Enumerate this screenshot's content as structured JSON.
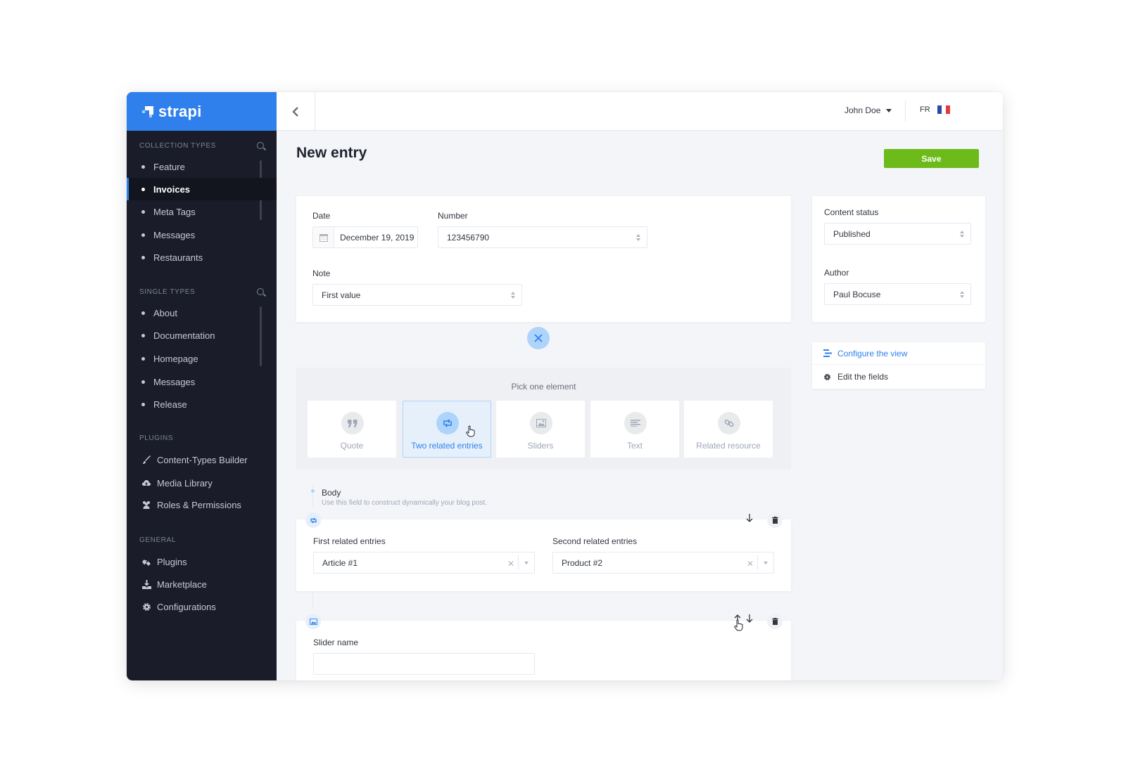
{
  "brand": {
    "name": "strapi"
  },
  "sidebar": {
    "collection_types": {
      "title": "Collection Types",
      "items": [
        {
          "label": "Feature"
        },
        {
          "label": "Invoices"
        },
        {
          "label": "Meta Tags"
        },
        {
          "label": "Messages"
        },
        {
          "label": "Restaurants"
        }
      ]
    },
    "single_types": {
      "title": "Single Types",
      "items": [
        {
          "label": "About"
        },
        {
          "label": "Documentation"
        },
        {
          "label": "Homepage"
        },
        {
          "label": "Messages"
        },
        {
          "label": "Release"
        }
      ]
    },
    "plugins": {
      "title": "Plugins",
      "items": [
        {
          "label": "Content-Types Builder",
          "icon": "brush-icon"
        },
        {
          "label": "Media Library",
          "icon": "cloud-upload-icon"
        },
        {
          "label": "Roles & Permissions",
          "icon": "users-icon"
        }
      ]
    },
    "general": {
      "title": "General",
      "items": [
        {
          "label": "Plugins",
          "icon": "puzzle-icon"
        },
        {
          "label": "Marketplace",
          "icon": "download-icon"
        },
        {
          "label": "Configurations",
          "icon": "gear-icon"
        }
      ]
    }
  },
  "header": {
    "user_name": "John Doe",
    "language": "FR",
    "flag_colors": [
      "#2b47a8",
      "#ffffff",
      "#e23a3f"
    ]
  },
  "main": {
    "title": "New entry",
    "save_label": "Save",
    "fields": {
      "date_label": "Date",
      "date_value": "December 19, 2019",
      "number_label": "Number",
      "number_value": "123456790",
      "note_label": "Note",
      "note_value": "First value"
    },
    "picker": {
      "title": "Pick one element",
      "options": [
        {
          "label": "Quote",
          "icon": "quote-icon"
        },
        {
          "label": "Two related entries",
          "icon": "retweet-icon",
          "selected": true
        },
        {
          "label": "Sliders",
          "icon": "image-icon"
        },
        {
          "label": "Text",
          "icon": "text-align-icon"
        },
        {
          "label": "Related resource",
          "icon": "link-icon"
        }
      ]
    },
    "body": {
      "label": "Body",
      "description": "Use this field to construct dynamically your blog post."
    },
    "related_component": {
      "first_label": "First related entries",
      "first_value": "Article #1",
      "second_label": "Second related entries",
      "second_value": "Product #2"
    },
    "slider_component": {
      "name_label": "Slider name"
    }
  },
  "right": {
    "content_status_label": "Content status",
    "content_status_value": "Published",
    "author_label": "Author",
    "author_value": "Paul Bocuse",
    "configure_view_label": "Configure the view",
    "edit_fields_label": "Edit the fields"
  },
  "colors": {
    "primary": "#2f80ed",
    "save": "#6dbb1a",
    "sidebar_bg": "#1a1d29"
  }
}
